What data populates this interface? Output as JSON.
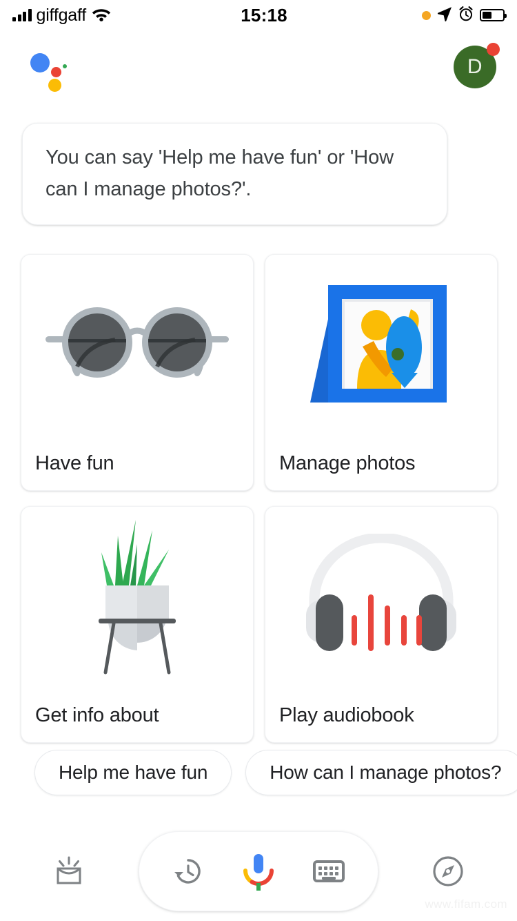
{
  "status_bar": {
    "carrier": "giffgaff",
    "time": "15:18",
    "signal_icon": "signal-bars-icon",
    "wifi_icon": "wifi-icon",
    "recording_icon": "orange-recording-dot-icon",
    "location_icon": "location-arrow-icon",
    "alarm_icon": "alarm-clock-icon",
    "battery_icon": "battery-icon"
  },
  "header": {
    "logo_icon": "google-assistant-logo-icon",
    "avatar_initial": "D",
    "avatar_badge": "notification-badge"
  },
  "message": {
    "text": "You can say 'Help me have fun' or 'How can I manage photos?'."
  },
  "cards": [
    {
      "label": "Have fun",
      "art": "sunglasses-illustration"
    },
    {
      "label": "Manage photos",
      "art": "picture-frame-illustration"
    },
    {
      "label": "Get info about",
      "art": "potted-plant-illustration"
    },
    {
      "label": "Play audiobook",
      "art": "headphones-illustration"
    }
  ],
  "suggestion_chips": [
    {
      "label": "Help me have fun"
    },
    {
      "label": "How can I manage photos?"
    }
  ],
  "bottom_bar": {
    "snapshot_icon": "snapshot-inbox-icon",
    "history_icon": "history-clock-icon",
    "mic_icon": "google-microphone-icon",
    "keyboard_icon": "keyboard-icon",
    "explore_icon": "explore-compass-icon"
  },
  "watermark": "www.fifam.com",
  "colors": {
    "google_blue": "#4285F4",
    "google_red": "#EA4335",
    "google_yellow": "#FBBC05",
    "google_green": "#34A853",
    "avatar_green": "#3A6B27",
    "frame_blue": "#1A73E8",
    "plant_green": "#2EA84F",
    "waveform_red": "#E8453C",
    "icon_gray": "#7E8285",
    "text_primary": "#202124"
  }
}
